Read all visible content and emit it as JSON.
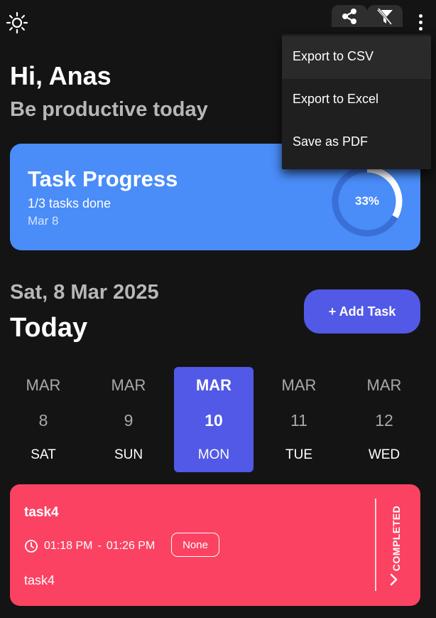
{
  "top_bar": {
    "theme_icon": "sun-icon",
    "share_icon": "share-icon",
    "filter_icon": "filter-icon",
    "more_icon": "more-vertical-icon"
  },
  "menu": {
    "items": [
      {
        "label": "Export to CSV",
        "active": true
      },
      {
        "label": "Export to Excel",
        "active": false
      },
      {
        "label": "Save as PDF",
        "active": false
      }
    ]
  },
  "greeting": {
    "title": "Hi, Anas",
    "subtitle": "Be productive today"
  },
  "progress": {
    "title": "Task Progress",
    "count_text": "1/3 tasks done",
    "date": "Mar 8",
    "percent_label": "33%",
    "percent_value": 0.33,
    "card_color": "#4a8cf8",
    "ring_color": "#ffffff",
    "ring_track_color": "#3a6fd8"
  },
  "date_section": {
    "date_label": "Sat, 8 Mar 2025",
    "heading": "Today",
    "add_button": "+ Add Task",
    "accent_color": "#5159e6"
  },
  "days": [
    {
      "month": "MAR",
      "day": "8",
      "weekday": "SAT",
      "selected": false
    },
    {
      "month": "MAR",
      "day": "9",
      "weekday": "SUN",
      "selected": false
    },
    {
      "month": "MAR",
      "day": "10",
      "weekday": "MON",
      "selected": true
    },
    {
      "month": "MAR",
      "day": "11",
      "weekday": "TUE",
      "selected": false
    },
    {
      "month": "MAR",
      "day": "12",
      "weekday": "WED",
      "selected": false
    }
  ],
  "task": {
    "title": "task4",
    "start_time": "01:18 PM",
    "end_time": "01:26 PM",
    "time_separator": "-",
    "tag": "None",
    "description": "task4",
    "status": "COMPLETED",
    "card_color": "#fb4262",
    "clock_icon": "clock-icon",
    "check_icon": "check-icon"
  }
}
